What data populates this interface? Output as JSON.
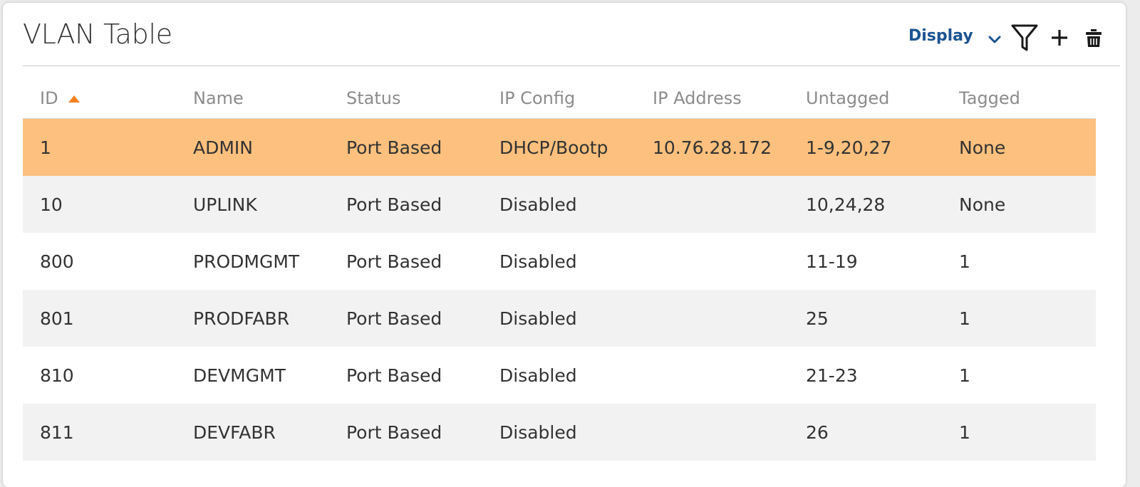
{
  "header": {
    "title": "VLAN Table",
    "display_label": "Display"
  },
  "colors": {
    "accent_orange": "#f5821f",
    "selected_row": "#fdc07e",
    "link_blue": "#1b5490"
  },
  "icons": [
    "chevron-down-icon",
    "filter-icon",
    "plus-icon",
    "trash-icon",
    "sort-ascending-icon"
  ],
  "table": {
    "sort": {
      "column": "ID",
      "direction": "ascending"
    },
    "columns": [
      "ID",
      "Name",
      "Status",
      "IP Config",
      "IP Address",
      "Untagged",
      "Tagged"
    ],
    "rows": [
      {
        "id": "1",
        "name": "ADMIN",
        "status": "Port Based",
        "ip_config": "DHCP/Bootp",
        "ip_address": "10.76.28.172",
        "untagged": "1-9,20,27",
        "tagged": "None",
        "selected": true
      },
      {
        "id": "10",
        "name": "UPLINK",
        "status": "Port Based",
        "ip_config": "Disabled",
        "ip_address": "",
        "untagged": "10,24,28",
        "tagged": "None",
        "selected": false
      },
      {
        "id": "800",
        "name": "PRODMGMT",
        "status": "Port Based",
        "ip_config": "Disabled",
        "ip_address": "",
        "untagged": "11-19",
        "tagged": "1",
        "selected": false
      },
      {
        "id": "801",
        "name": "PRODFABR",
        "status": "Port Based",
        "ip_config": "Disabled",
        "ip_address": "",
        "untagged": "25",
        "tagged": "1",
        "selected": false
      },
      {
        "id": "810",
        "name": "DEVMGMT",
        "status": "Port Based",
        "ip_config": "Disabled",
        "ip_address": "",
        "untagged": "21-23",
        "tagged": "1",
        "selected": false
      },
      {
        "id": "811",
        "name": "DEVFABR",
        "status": "Port Based",
        "ip_config": "Disabled",
        "ip_address": "",
        "untagged": "26",
        "tagged": "1",
        "selected": false
      }
    ]
  }
}
